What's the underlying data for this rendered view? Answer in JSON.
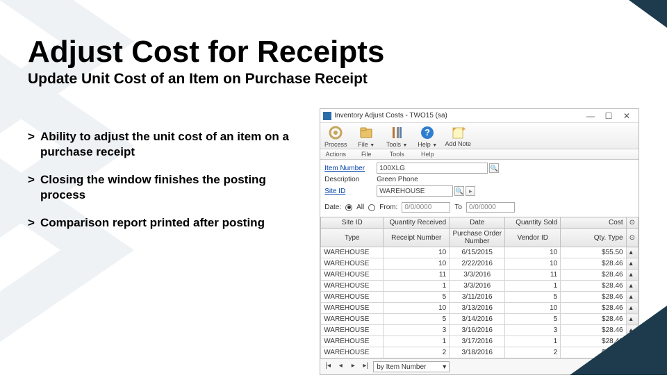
{
  "slide": {
    "title": "Adjust Cost for Receipts",
    "subtitle": "Update Unit Cost of an Item on Purchase Receipt",
    "bullets": [
      "Ability to adjust the unit cost of an item on a purchase receipt",
      "Closing the window finishes the posting process",
      "Comparison report printed after posting"
    ]
  },
  "window": {
    "title": "Inventory Adjust Costs  -  TWO15 (sa)",
    "toolbar": [
      {
        "label": "Process",
        "sub": "Actions",
        "icon": "process"
      },
      {
        "label": "File",
        "sub": "File",
        "icon": "file",
        "drop": true
      },
      {
        "label": "Tools",
        "sub": "Tools",
        "icon": "tools",
        "drop": true
      },
      {
        "label": "Help",
        "sub": "Help",
        "icon": "help",
        "drop": true
      },
      {
        "label": "Add Note",
        "sub": "",
        "icon": "note"
      }
    ],
    "labels": {
      "item_number": "Item Number",
      "description": "Description",
      "site_id": "Site ID",
      "date": "Date:",
      "all": "All",
      "from": "From:",
      "to": "To"
    },
    "values": {
      "item_number": "100XLG",
      "description": "Green Phone",
      "site_id": "WAREHOUSE",
      "from_date": "0/0/0000",
      "to_date": "0/0/0000"
    },
    "columns1": [
      "Site ID",
      "Quantity Received",
      "Date",
      "Quantity Sold",
      "Cost"
    ],
    "columns2": [
      "Type",
      "Receipt Number",
      "Purchase Order Number",
      "Vendor ID",
      "Qty. Type"
    ],
    "rows": [
      {
        "site": "WAREHOUSE",
        "qtyr": "10",
        "date": "6/15/2015",
        "qtys": "10",
        "cost": "$55.50"
      },
      {
        "site": "WAREHOUSE",
        "qtyr": "10",
        "date": "2/22/2016",
        "qtys": "10",
        "cost": "$28.46"
      },
      {
        "site": "WAREHOUSE",
        "qtyr": "11",
        "date": "3/3/2016",
        "qtys": "11",
        "cost": "$28.46"
      },
      {
        "site": "WAREHOUSE",
        "qtyr": "1",
        "date": "3/3/2016",
        "qtys": "1",
        "cost": "$28.46"
      },
      {
        "site": "WAREHOUSE",
        "qtyr": "5",
        "date": "3/11/2016",
        "qtys": "5",
        "cost": "$28.46"
      },
      {
        "site": "WAREHOUSE",
        "qtyr": "10",
        "date": "3/13/2016",
        "qtys": "10",
        "cost": "$28.46"
      },
      {
        "site": "WAREHOUSE",
        "qtyr": "5",
        "date": "3/14/2016",
        "qtys": "5",
        "cost": "$28.46"
      },
      {
        "site": "WAREHOUSE",
        "qtyr": "3",
        "date": "3/16/2016",
        "qtys": "3",
        "cost": "$28.46"
      },
      {
        "site": "WAREHOUSE",
        "qtyr": "1",
        "date": "3/17/2016",
        "qtys": "1",
        "cost": "$28.46"
      },
      {
        "site": "WAREHOUSE",
        "qtyr": "2",
        "date": "3/18/2016",
        "qtys": "2",
        "cost": "$28.46"
      }
    ],
    "sort_label": "by Item Number"
  }
}
